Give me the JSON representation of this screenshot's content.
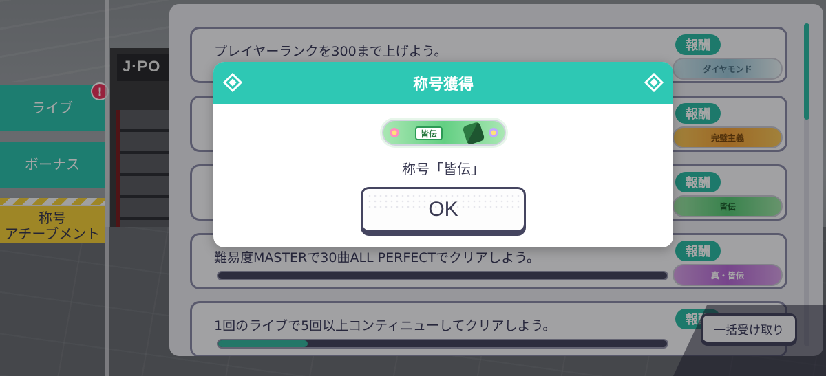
{
  "left_tabs": {
    "live": "ライブ",
    "bonus": "ボーナス",
    "title_line1": "称号",
    "title_line2": "アチーブメント",
    "alert_badge": "!"
  },
  "store_sign": "J·PO",
  "missions": [
    {
      "text": "プレイヤーランクを300まで上げよう。",
      "reward_label": "報酬",
      "reward_item": "ダイヤモンド",
      "progress": null
    },
    {
      "text": "",
      "reward_label": "報酬",
      "reward_item": "完璧主義",
      "progress": null
    },
    {
      "text": "",
      "reward_label": "報酬",
      "reward_item": "皆伝",
      "progress": null
    },
    {
      "text": "難易度MASTERで30曲ALL PERFECTでクリアしよう。",
      "reward_label": "報酬",
      "reward_item": "真・皆伝",
      "progress": 0.0
    },
    {
      "text": "1回のライブで5回以上コンティニューしてクリアしよう。",
      "reward_label": "報酬",
      "reward_item": "",
      "progress": 0.2
    }
  ],
  "collect_all_button": "一括受け取り",
  "modal": {
    "title": "称号獲得",
    "plate_badge": "皆伝",
    "message": "称号「皆伝」",
    "ok_label": "OK"
  },
  "colors": {
    "accent_teal": "#2ec8b4",
    "navy": "#454560",
    "alert_pink": "#e9345c",
    "tab_yellow": "#f3ce3b"
  },
  "icons": [
    "diamond-icon",
    "glowstick-icon",
    "flower-icon",
    "alert-icon"
  ]
}
